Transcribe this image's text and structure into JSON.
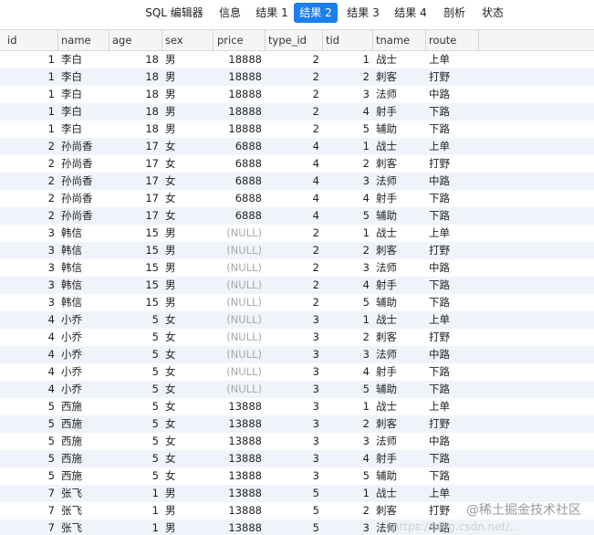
{
  "tabs": [
    {
      "label": "SQL 编辑器",
      "active": false
    },
    {
      "label": "信息",
      "active": false
    },
    {
      "label": "结果 1",
      "active": false
    },
    {
      "label": "结果 2",
      "active": true
    },
    {
      "label": "结果 3",
      "active": false
    },
    {
      "label": "结果 4",
      "active": false
    },
    {
      "label": "剖析",
      "active": false
    },
    {
      "label": "状态",
      "active": false
    }
  ],
  "columns": [
    "id",
    "name",
    "age",
    "sex",
    "price",
    "type_id",
    "tid",
    "tname",
    "route"
  ],
  "null_text": "(NULL)",
  "rows": [
    [
      "1",
      "李白",
      "18",
      "男",
      "18888",
      "2",
      "1",
      "战士",
      "上单"
    ],
    [
      "1",
      "李白",
      "18",
      "男",
      "18888",
      "2",
      "2",
      "刺客",
      "打野"
    ],
    [
      "1",
      "李白",
      "18",
      "男",
      "18888",
      "2",
      "3",
      "法师",
      "中路"
    ],
    [
      "1",
      "李白",
      "18",
      "男",
      "18888",
      "2",
      "4",
      "射手",
      "下路"
    ],
    [
      "1",
      "李白",
      "18",
      "男",
      "18888",
      "2",
      "5",
      "辅助",
      "下路"
    ],
    [
      "2",
      "孙尚香",
      "17",
      "女",
      "6888",
      "4",
      "1",
      "战士",
      "上单"
    ],
    [
      "2",
      "孙尚香",
      "17",
      "女",
      "6888",
      "4",
      "2",
      "刺客",
      "打野"
    ],
    [
      "2",
      "孙尚香",
      "17",
      "女",
      "6888",
      "4",
      "3",
      "法师",
      "中路"
    ],
    [
      "2",
      "孙尚香",
      "17",
      "女",
      "6888",
      "4",
      "4",
      "射手",
      "下路"
    ],
    [
      "2",
      "孙尚香",
      "17",
      "女",
      "6888",
      "4",
      "5",
      "辅助",
      "下路"
    ],
    [
      "3",
      "韩信",
      "15",
      "男",
      null,
      "2",
      "1",
      "战士",
      "上单"
    ],
    [
      "3",
      "韩信",
      "15",
      "男",
      null,
      "2",
      "2",
      "刺客",
      "打野"
    ],
    [
      "3",
      "韩信",
      "15",
      "男",
      null,
      "2",
      "3",
      "法师",
      "中路"
    ],
    [
      "3",
      "韩信",
      "15",
      "男",
      null,
      "2",
      "4",
      "射手",
      "下路"
    ],
    [
      "3",
      "韩信",
      "15",
      "男",
      null,
      "2",
      "5",
      "辅助",
      "下路"
    ],
    [
      "4",
      "小乔",
      "5",
      "女",
      null,
      "3",
      "1",
      "战士",
      "上单"
    ],
    [
      "4",
      "小乔",
      "5",
      "女",
      null,
      "3",
      "2",
      "刺客",
      "打野"
    ],
    [
      "4",
      "小乔",
      "5",
      "女",
      null,
      "3",
      "3",
      "法师",
      "中路"
    ],
    [
      "4",
      "小乔",
      "5",
      "女",
      null,
      "3",
      "4",
      "射手",
      "下路"
    ],
    [
      "4",
      "小乔",
      "5",
      "女",
      null,
      "3",
      "5",
      "辅助",
      "下路"
    ],
    [
      "5",
      "西施",
      "5",
      "女",
      "13888",
      "3",
      "1",
      "战士",
      "上单"
    ],
    [
      "5",
      "西施",
      "5",
      "女",
      "13888",
      "3",
      "2",
      "刺客",
      "打野"
    ],
    [
      "5",
      "西施",
      "5",
      "女",
      "13888",
      "3",
      "3",
      "法师",
      "中路"
    ],
    [
      "5",
      "西施",
      "5",
      "女",
      "13888",
      "3",
      "4",
      "射手",
      "下路"
    ],
    [
      "5",
      "西施",
      "5",
      "女",
      "13888",
      "3",
      "5",
      "辅助",
      "下路"
    ],
    [
      "7",
      "张飞",
      "1",
      "男",
      "13888",
      "5",
      "1",
      "战士",
      "上单"
    ],
    [
      "7",
      "张飞",
      "1",
      "男",
      "13888",
      "5",
      "2",
      "刺客",
      "打野"
    ],
    [
      "7",
      "张飞",
      "1",
      "男",
      "13888",
      "5",
      "3",
      "法师",
      "中路"
    ]
  ],
  "watermark": "@稀土掘金技术社区",
  "watermark_url": "https://blog.csdn.net/..."
}
